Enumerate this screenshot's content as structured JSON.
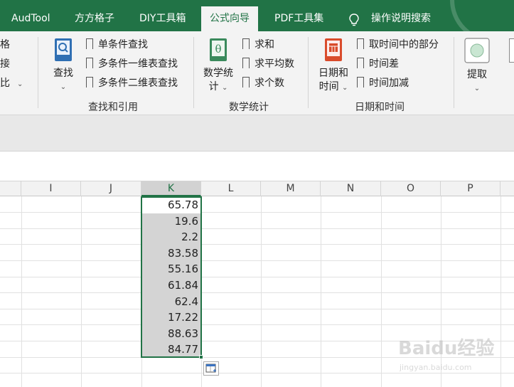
{
  "tabs": [
    "AudTool",
    "方方格子",
    "DIY工具箱",
    "公式向导",
    "PDF工具集"
  ],
  "active_tab": "公式向导",
  "tell_me": "操作说明搜索",
  "left_cut_items": [
    "格",
    "接",
    "比"
  ],
  "groups": {
    "lookup": {
      "label": "查找和引用",
      "big_button": "查找",
      "items": [
        "单条件查找",
        "多条件一维表查找",
        "多条件二维表查找"
      ]
    },
    "math": {
      "label": "数学统计",
      "big_button_line1": "数学统",
      "big_button_line2": "计",
      "items": [
        "求和",
        "求平均数",
        "求个数"
      ]
    },
    "datetime": {
      "label": "日期和时间",
      "big_button_line1": "日期和",
      "big_button_line2": "时间",
      "items": [
        "取时间中的部分",
        "时间差",
        "时间加减"
      ]
    },
    "extract": {
      "big_button": "提取"
    }
  },
  "columns": [
    "I",
    "J",
    "K",
    "L",
    "M",
    "N",
    "O",
    "P"
  ],
  "selected_column": "K",
  "k_values": [
    "65.78",
    "19.6",
    "2.2",
    "83.58",
    "55.16",
    "61.84",
    "62.4",
    "17.22",
    "88.63",
    "84.77"
  ],
  "watermark": {
    "brand": "Baidu经验",
    "url": "jingyan.baidu.com"
  }
}
